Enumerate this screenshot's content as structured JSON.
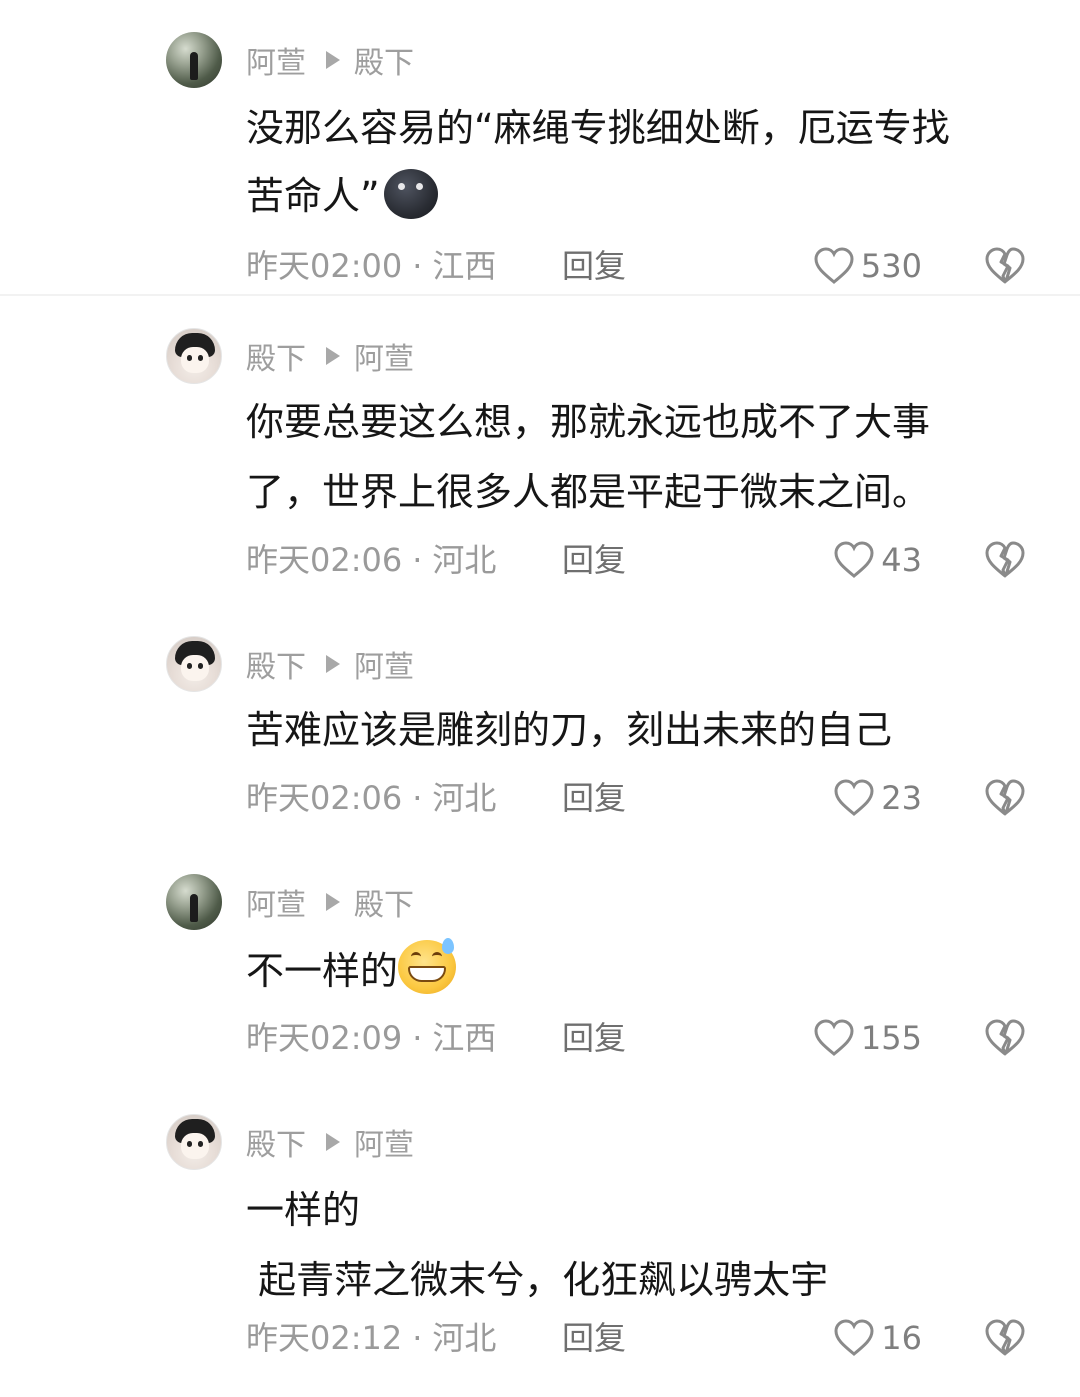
{
  "comments": [
    {
      "author": "阿萱",
      "reply_to": "殿下",
      "text_lines": [
        "没那么容易的“麻绳专挑细处断，厄运专找",
        "苦命人”"
      ],
      "emoji": "dark-face-emoji",
      "time": "昨天02:00",
      "location": "江西",
      "reply_label": "回复",
      "likes": "530"
    },
    {
      "author": "殿下",
      "reply_to": "阿萱",
      "text_lines": [
        "你要总要这么想，那就永远也成不了大事",
        "了，世界上很多人都是平起于微末之间。"
      ],
      "time": "昨天02:06",
      "location": "河北",
      "reply_label": "回复",
      "likes": "43"
    },
    {
      "author": "殿下",
      "reply_to": "阿萱",
      "text_lines": [
        "苦难应该是雕刻的刀，刻出未来的自己"
      ],
      "time": "昨天02:06",
      "location": "河北",
      "reply_label": "回复",
      "likes": "23"
    },
    {
      "author": "阿萱",
      "reply_to": "殿下",
      "text_lines": [
        "不一样的"
      ],
      "emoji": "grinning-sweat-emoji",
      "time": "昨天02:09",
      "location": "江西",
      "reply_label": "回复",
      "likes": "155"
    },
    {
      "author": "殿下",
      "reply_to": "阿萱",
      "text_lines": [
        "一样的",
        " 起青萍之微末兮，化狂飙以骋太宇"
      ],
      "time": "昨天02:12",
      "location": "河北",
      "reply_label": "回复",
      "likes": "16"
    }
  ],
  "separator": "·",
  "icons": {
    "like": "heart-outline-icon",
    "dislike": "broken-heart-icon",
    "reply_arrow": "triangle-right-icon"
  },
  "colors": {
    "text": "#161616",
    "meta": "#9e9e9e",
    "background": "#ffffff"
  }
}
